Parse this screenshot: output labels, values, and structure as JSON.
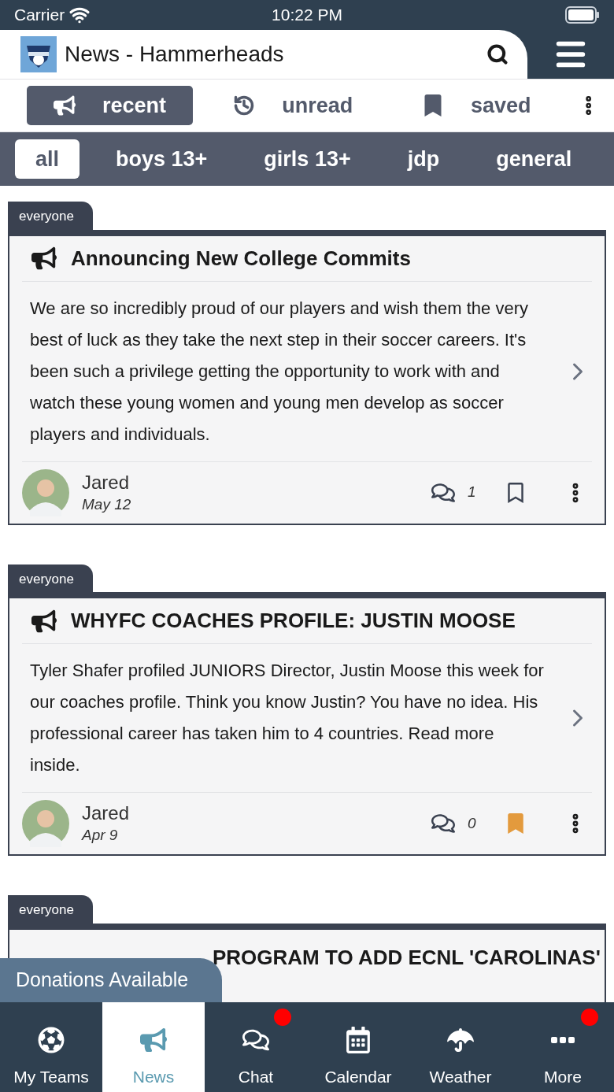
{
  "status_bar": {
    "carrier": "Carrier",
    "time": "10:22 PM"
  },
  "header": {
    "title": "News - Hammerheads"
  },
  "filters": [
    {
      "label": "recent",
      "selected": true
    },
    {
      "label": "unread",
      "selected": false
    },
    {
      "label": "saved",
      "selected": false
    }
  ],
  "categories": [
    {
      "label": "all",
      "selected": true
    },
    {
      "label": "boys 13+",
      "selected": false
    },
    {
      "label": "girls 13+",
      "selected": false
    },
    {
      "label": "jdp",
      "selected": false
    },
    {
      "label": "general",
      "selected": false
    }
  ],
  "posts": [
    {
      "kind": "full",
      "audience": "everyone",
      "title": "Announcing New College Commits",
      "body": "We are so incredibly proud of our players and wish them the very best of luck as they take the next step in their soccer careers. It's been such a privilege getting the opportunity to work with and watch these young women and young men develop as soccer players and individuals.",
      "author": "Jared",
      "date": "May 12",
      "comments": "1",
      "saved": false
    },
    {
      "kind": "full",
      "audience": "everyone",
      "title": "WHYFC COACHES PROFILE: JUSTIN MOOSE",
      "body": "Tyler Shafer profiled JUNIORS Director, Justin Moose this week for our coaches profile.  Think you know Justin?  You have no idea.  His professional career has taken him to 4 countries.  Read more inside.",
      "author": "Jared",
      "date": "Apr 9",
      "comments": "0",
      "saved": true
    },
    {
      "kind": "cut",
      "audience": "everyone",
      "title": "PROGRAM TO ADD ECNL 'CAROLINAS'"
    }
  ],
  "donations_banner": "Donations Available",
  "tab_bar": [
    {
      "label": "My Teams",
      "selected": false,
      "badge": false
    },
    {
      "label": "News",
      "selected": true,
      "badge": false
    },
    {
      "label": "Chat",
      "selected": false,
      "badge": true
    },
    {
      "label": "Calendar",
      "selected": false,
      "badge": false
    },
    {
      "label": "Weather",
      "selected": false,
      "badge": false
    },
    {
      "label": "More",
      "selected": false,
      "badge": true
    }
  ]
}
